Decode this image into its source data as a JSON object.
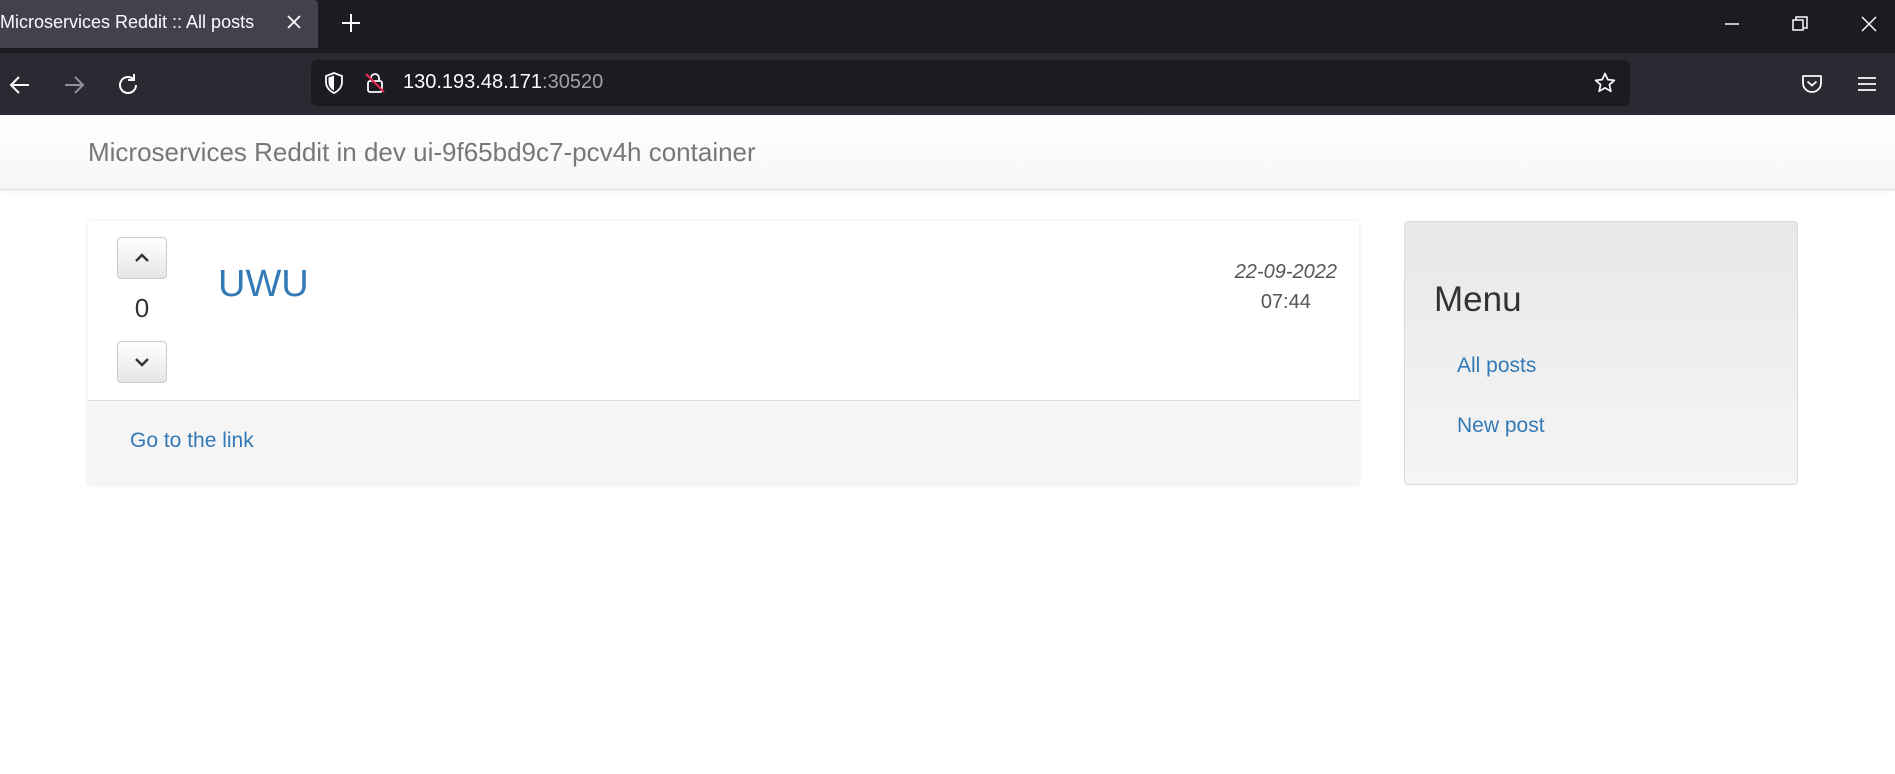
{
  "browser": {
    "tab_title": "Microservices Reddit :: All posts",
    "url_host": "130.193.48.171",
    "url_port": ":30520",
    "icons": [
      "close-icon",
      "plus-icon",
      "minimize-icon",
      "restore-icon",
      "close-window-icon",
      "back-arrow-icon",
      "forward-arrow-icon",
      "reload-icon",
      "shield-icon",
      "insecure-lock-icon",
      "star-icon",
      "pocket-icon",
      "hamburger-menu-icon"
    ]
  },
  "site": {
    "brand": "Microservices Reddit in dev ui-9f65bd9c7-pcv4h container"
  },
  "post": {
    "votes": "0",
    "title": "UWU",
    "date": "22-09-2022",
    "time": "07:44",
    "link_label": "Go to the link"
  },
  "sidebar": {
    "heading": "Menu",
    "items": [
      {
        "label": "All posts"
      },
      {
        "label": "New post"
      }
    ]
  },
  "colors": {
    "link": "#337ab7",
    "brand_text": "#777777",
    "chrome_dark": "#1c1b22",
    "chrome_toolbar": "#2b2a33"
  }
}
